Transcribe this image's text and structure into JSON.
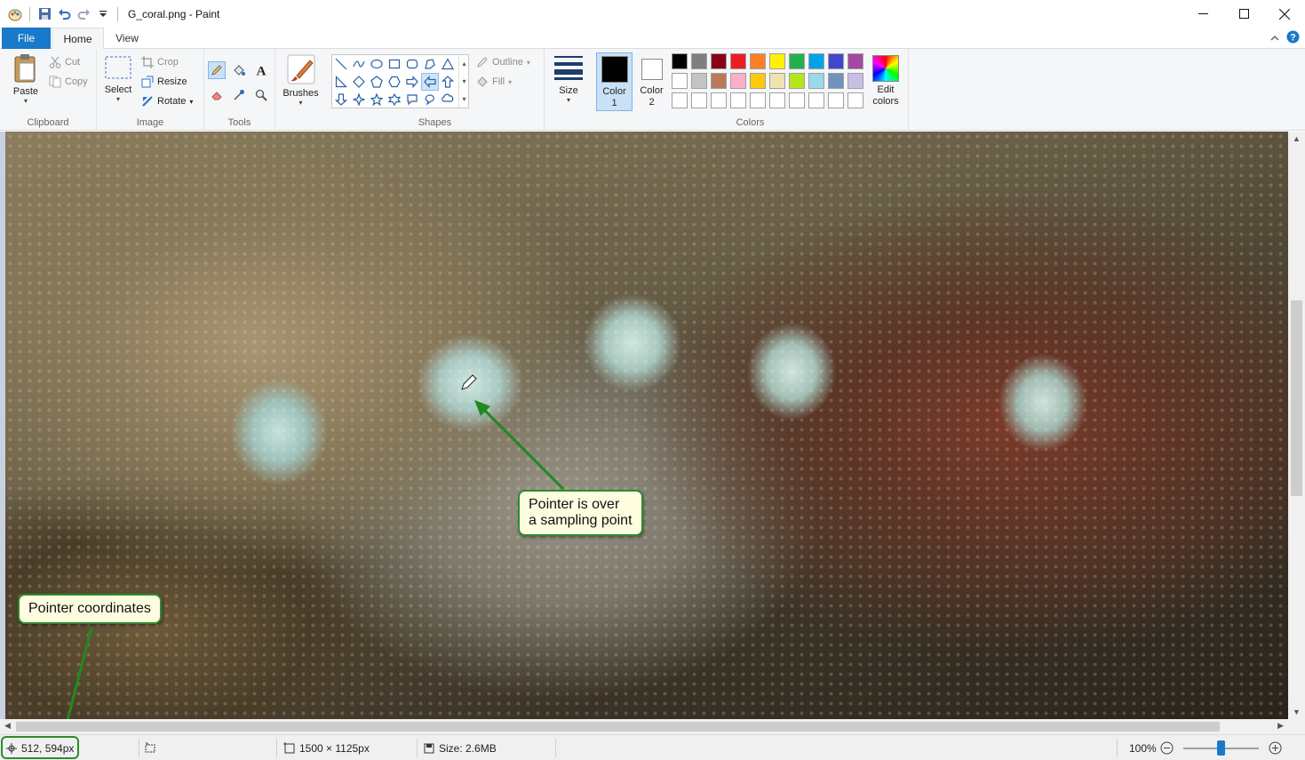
{
  "window": {
    "title": "G_coral.png - Paint"
  },
  "tabs": [
    {
      "label": "File"
    },
    {
      "label": "Home"
    },
    {
      "label": "View"
    }
  ],
  "ribbon": {
    "clipboard": {
      "group": "Clipboard",
      "paste": "Paste",
      "cut": "Cut",
      "copy": "Copy"
    },
    "image": {
      "group": "Image",
      "select": "Select",
      "crop": "Crop",
      "resize": "Resize",
      "rotate": "Rotate"
    },
    "tools": {
      "group": "Tools",
      "icons": [
        "pencil-icon",
        "fill-icon",
        "text-icon",
        "eraser-icon",
        "color-picker-icon",
        "magnifier-icon"
      ]
    },
    "brushes": {
      "label": "Brushes"
    },
    "shapes": {
      "group": "Shapes",
      "outline": "Outline",
      "fill": "Fill"
    },
    "size": {
      "label": "Size"
    },
    "colors": {
      "group": "Colors",
      "color1": {
        "label": "Color",
        "num": "1",
        "value": "#000000"
      },
      "color2": {
        "label": "Color",
        "num": "2",
        "value": "#ffffff"
      },
      "edit_line1": "Edit",
      "edit_line2": "colors",
      "palette_row1": [
        "#000000",
        "#7f7f7f",
        "#880015",
        "#ed1c24",
        "#ff7f27",
        "#fff200",
        "#22b14c",
        "#00a2e8",
        "#3f48cc",
        "#a349a4"
      ],
      "palette_row2": [
        "#ffffff",
        "#c3c3c3",
        "#b97a57",
        "#ffaec9",
        "#ffc90e",
        "#efe4b0",
        "#b5e61d",
        "#99d9ea",
        "#7092be",
        "#c8bfe7"
      ],
      "palette_row3": [
        "#ffffff",
        "#ffffff",
        "#ffffff",
        "#ffffff",
        "#ffffff",
        "#ffffff",
        "#ffffff",
        "#ffffff",
        "#ffffff",
        "#ffffff"
      ]
    }
  },
  "callouts": {
    "pointer_line1": "Pointer is over",
    "pointer_line2": "a sampling point",
    "coords": "Pointer coordinates"
  },
  "statusbar": {
    "position": "512, 594px",
    "dimensions": "1500 × 1125px",
    "size": "Size: 2.6MB",
    "zoom": "100%"
  },
  "accent": "#1979ca",
  "callout_border": "#2e8b2e"
}
